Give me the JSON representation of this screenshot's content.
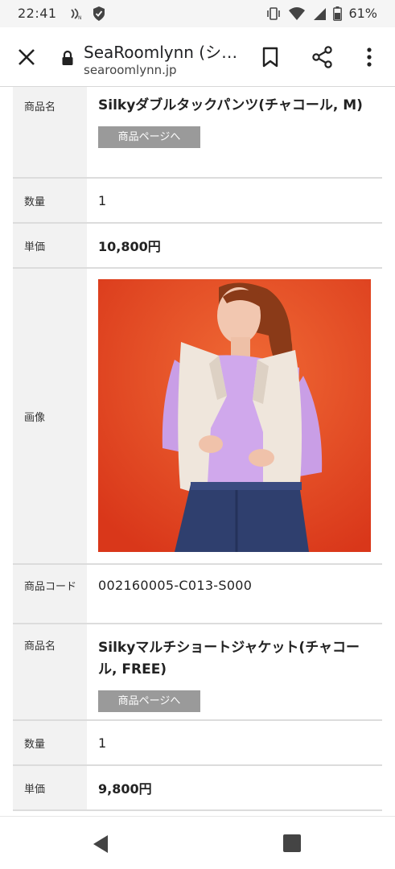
{
  "status_bar": {
    "time": "22:41",
    "battery_percent": "61%",
    "icons": [
      "nfc-icon",
      "shield-icon",
      "vibrate-icon",
      "wifi-icon",
      "signal-icon",
      "battery-icon"
    ]
  },
  "browser": {
    "title": "SeaRoomlynn (シ…",
    "url": "searoomlynn.jp",
    "icons": [
      "close-icon",
      "lock-icon",
      "bookmark-icon",
      "share-icon",
      "more-vert-icon"
    ]
  },
  "items": [
    {
      "name_label": "商品名",
      "name": "Silkyダブルタックパンツ(チャコール, M)",
      "product_button": "商品ページへ",
      "qty_label": "数量",
      "qty": "1",
      "price_label": "単価",
      "price": "10,800円"
    },
    {
      "image_label": "画像",
      "code_label": "商品コード",
      "code": "002160005-C013-S000",
      "name_label": "商品名",
      "name": "Silkyマルチショートジャケット(チャコール, FREE)",
      "product_button": "商品ページへ",
      "qty_label": "数量",
      "qty": "1",
      "price_label": "単価",
      "price": "9,800円"
    }
  ],
  "colors": {
    "label_bg": "#f2f2f2",
    "button_bg": "#9a9a9a",
    "image_bg": "#e8491f"
  },
  "nav": {
    "icons": [
      "back-icon",
      "home-icon",
      "recents-icon"
    ]
  }
}
